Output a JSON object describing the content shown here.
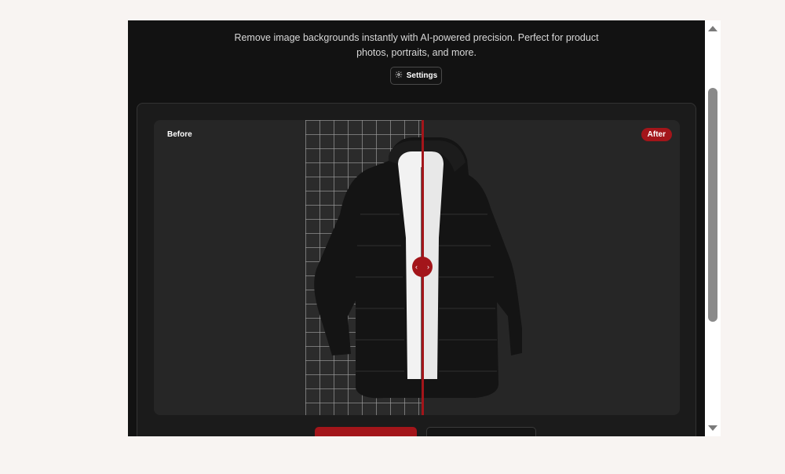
{
  "app": {
    "description_line1": "Remove image backgrounds instantly with AI-powered precision. Perfect for product",
    "description_line2": "photos, portraits, and more.",
    "settings_label": "Settings"
  },
  "comparison": {
    "before_label": "Before",
    "after_label": "After",
    "slider_position": 0.51
  },
  "colors": {
    "accent": "#a3151a",
    "background": "#121212",
    "stage": "#262626"
  },
  "icons": [
    "gear-icon",
    "chevron-left-icon",
    "chevron-right-icon"
  ]
}
